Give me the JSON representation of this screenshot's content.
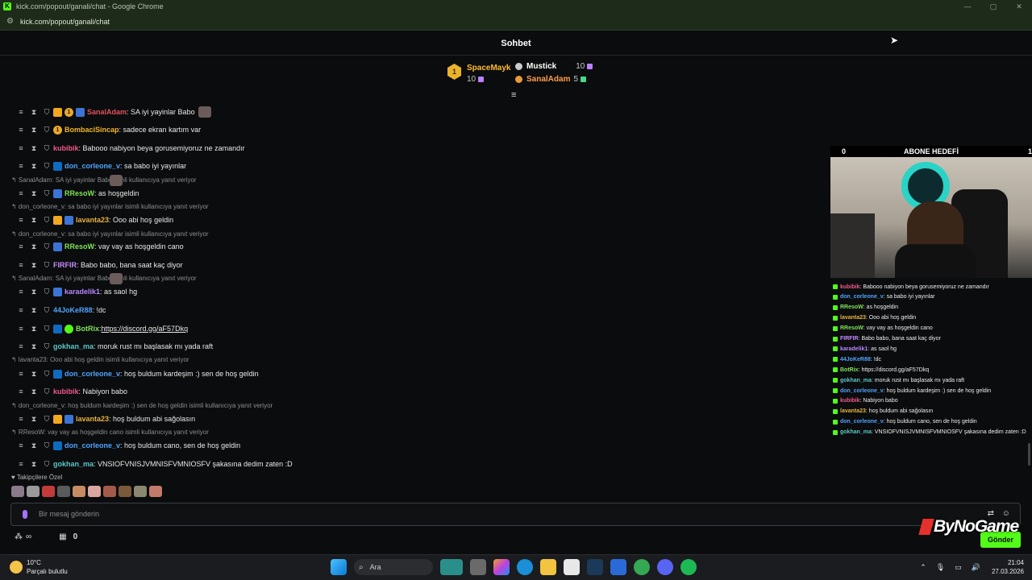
{
  "window": {
    "title": "kick.com/popout/ganali/chat - Google Chrome",
    "url": "kick.com/popout/ganali/chat",
    "controls": [
      "—",
      "▢",
      "✕"
    ]
  },
  "chat_header": {
    "title": "Sohbet"
  },
  "leaderboard": {
    "first": {
      "rank": "1",
      "name": "SpaceMayk",
      "count": "10"
    },
    "others": [
      {
        "name": "Mustick",
        "count": "10"
      },
      {
        "name": "SanalAdam",
        "count": "5"
      }
    ]
  },
  "filter_icon": "filter-icon",
  "messages": [
    {
      "user": "SanalAdam",
      "color": "#e0525e",
      "text": ": SA iyi yayinlar Babo"
    },
    {
      "user": "BombaciSincap",
      "color": "#f2b52a",
      "text": ": sadece ekran kartım var"
    },
    {
      "user": "kubibik",
      "color": "#f05a8a",
      "text": ": Babooo nabiyon beya gorusemiyoruz ne zamandır"
    },
    {
      "user": "don_corleone_v",
      "color": "#4fa3ff",
      "text": ": sa babo iyi yayınlar"
    },
    {
      "user": "RResoW",
      "color": "#7fe35a",
      "text": ": as hoşgeldin"
    },
    {
      "user": "lavanta23",
      "color": "#e7b340",
      "text": ": Ooo abi hoş geldin"
    },
    {
      "user": "RResoW",
      "color": "#7fe35a",
      "text": ": vay vay as hoşgeldin cano"
    },
    {
      "user": "FIRFIR",
      "color": "#c58bff",
      "text": ": Babo babo, bana saat kaç diyor"
    },
    {
      "user": "karadelik1",
      "color": "#b787ff",
      "text": ": as saol hg"
    },
    {
      "user": "44JoKeR88",
      "color": "#4fa3ff",
      "text": ": !dc"
    },
    {
      "user": "BotRix",
      "color": "#7fe35a",
      "text": ": ",
      "link": "https://discord.gg/aF57Dkq"
    },
    {
      "user": "gokhan_ma",
      "color": "#5ac8c8",
      "text": ": moruk rust mı başlasak mı yada raft"
    },
    {
      "user": "don_corleone_v",
      "color": "#4fa3ff",
      "text": ": hoş buldum kardeşim :) sen de hoş geldin"
    },
    {
      "user": "kubibik",
      "color": "#f05a8a",
      "text": ": Nabiyon babo"
    },
    {
      "user": "lavanta23",
      "color": "#e7b340",
      "text": ": hoş buldum abi sağolasın"
    },
    {
      "user": "don_corleone_v",
      "color": "#4fa3ff",
      "text": ": hoş buldum cano, sen de hoş geldin"
    },
    {
      "user": "gokhan_ma",
      "color": "#5ac8c8",
      "text": ": VNSIOFVNISJVMNISFVMNIOSFV şakasına dedim zaten :D"
    }
  ],
  "replies": [
    "SanalAdam: SA iyi yayinlar Babo",
    "isimli kullanıcıya yanıt veriyor",
    "don_corleone_v: sa babo iyi yayınlar isimli kullanıcıya yanıt veriyor",
    "don_corleone_v: sa babo iyi yayınlar isimli kullanıcıya yanıt veriyor",
    "SanalAdam: SA iyi yayinlar Babo",
    "isimli kullanıcıya yanıt veriyor",
    "lavanta23: Ooo abi hoş geldin isimli kullanıcıya yanıt veriyor",
    "don_corleone_v: hoş buldum kardeşim :) sen de hoş geldin isimli kullanıcıya yanıt veriyor",
    "RResoW: vay vay as hoşgeldin cano isimli kullanıcıya yanıt veriyor"
  ],
  "followers_only": "Takipçilere Özel",
  "input": {
    "placeholder": "Bir mesaj gönderin",
    "send_label": "Gönder"
  },
  "bottom": {
    "infinity": "∞",
    "count": "0"
  },
  "overlay": {
    "goal_left": "0",
    "goal_title": "ABONE HEDEFİ",
    "goal_right": "1",
    "logo": "ByNoGame",
    "mini_chat": [
      {
        "user": "kubibik",
        "color": "#f05a8a",
        "text": " : Babooo nabiyon beya gorusemiyoruz ne zamandır"
      },
      {
        "user": "don_corleone_v",
        "color": "#4fa3ff",
        "text": " : sa babo iyi yayınlar"
      },
      {
        "user": "RResoW",
        "color": "#7fe35a",
        "text": " : as hoşgeldin"
      },
      {
        "user": "lavanta23",
        "color": "#e7b340",
        "text": " : Ooo abi hoş geldin"
      },
      {
        "user": "RResoW",
        "color": "#7fe35a",
        "text": " : vay vay as hoşgeldin cano"
      },
      {
        "user": "FIRFIR",
        "color": "#c58bff",
        "text": " : Babo babo, bana saat kaç diyor"
      },
      {
        "user": "karadelik1",
        "color": "#b787ff",
        "text": " : as saol hg"
      },
      {
        "user": "44JoKeR88",
        "color": "#4fa3ff",
        "text": " : !dc"
      },
      {
        "user": "BotRix",
        "color": "#7fe35a",
        "text": " : https://discord.gg/aF57Dkq"
      },
      {
        "user": "gokhan_ma",
        "color": "#5ac8c8",
        "text": " : moruk rust mı başlasak mı yada raft"
      },
      {
        "user": "don_corleone_v",
        "color": "#4fa3ff",
        "text": " : hoş buldum kardeşim :) sen de hoş geldin"
      },
      {
        "user": "kubibik",
        "color": "#f05a8a",
        "text": " : Nabiyon babo"
      },
      {
        "user": "lavanta23",
        "color": "#e7b340",
        "text": " : hoş buldum abi sağolasın"
      },
      {
        "user": "don_corleone_v",
        "color": "#4fa3ff",
        "text": " : hoş buldum cano, sen de hoş geldin"
      },
      {
        "user": "gokhan_ma",
        "color": "#5ac8c8",
        "text": " : VNSIOFVNISJVMNISFVMNIOSFV şakasına dedim zaten :D"
      }
    ]
  },
  "taskbar": {
    "weather_temp": "10°C",
    "weather_desc": "Parçalı bulutlu",
    "search_label": "Ara",
    "time": "21:04",
    "date": "27.03.2026",
    "apps": [
      "start-icon",
      "search",
      "widgets-icon",
      "file-explorer-icon",
      "copilot-icon",
      "edge-icon",
      "folder-icon",
      "store-icon",
      "steam-icon",
      "mail-icon",
      "chrome-icon",
      "discord-icon",
      "spotify-icon"
    ]
  },
  "colors": {
    "accent": "#53fc18",
    "background": "#0b0c0d"
  }
}
